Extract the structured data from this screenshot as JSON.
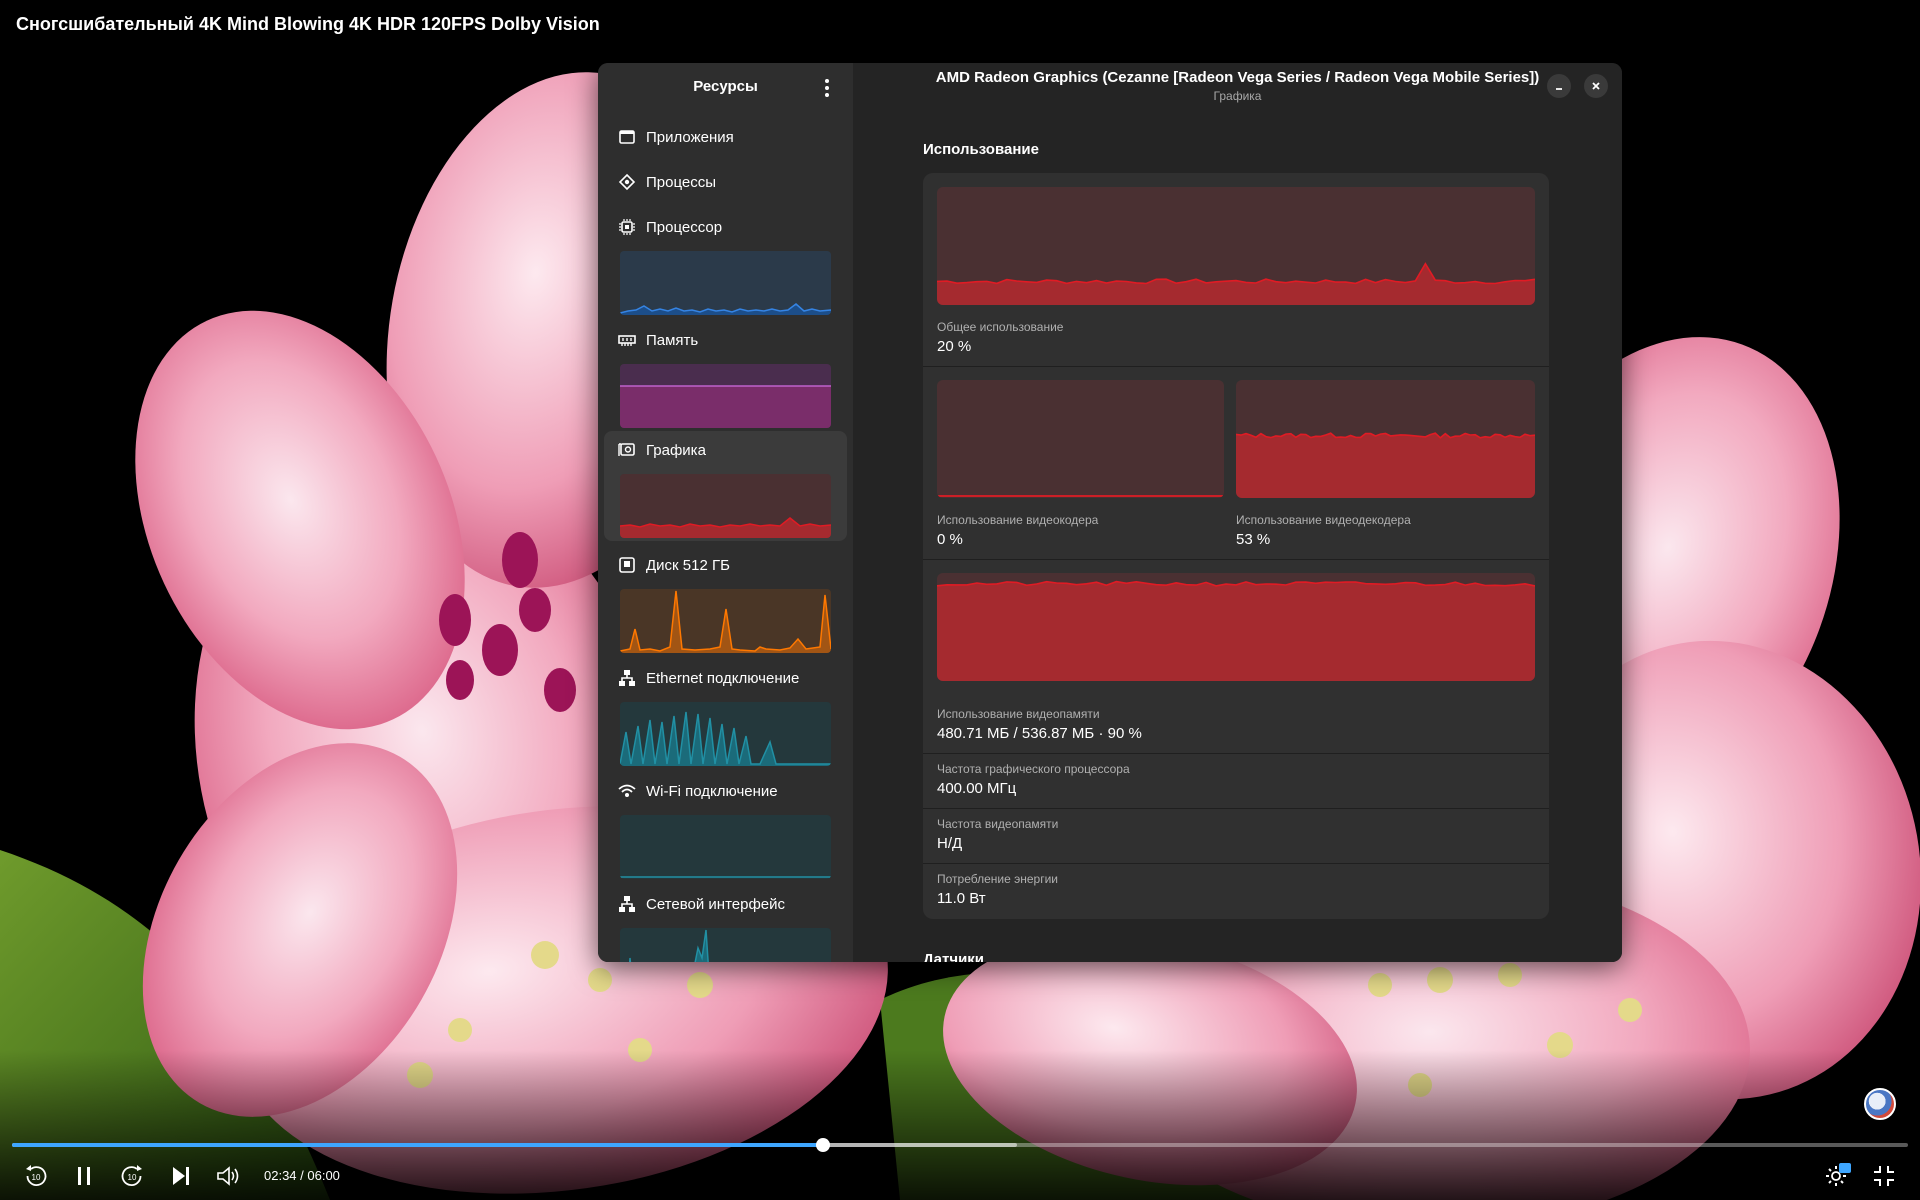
{
  "video": {
    "title": "Сногсшибательный 4K Mind Blowing 4K HDR 120FPS Dolby Vision",
    "time_display": "02:34 / 06:00",
    "played_fraction": 0.428,
    "buffered_fraction": 0.53,
    "controls": [
      "rewind-10-icon",
      "pause-icon",
      "forward-10-icon",
      "next-icon",
      "volume-icon",
      "settings-icon",
      "exit-fullscreen-icon"
    ]
  },
  "window": {
    "sidebar_title": "Ресурсы",
    "title": "AMD Radeon Graphics (Cezanne [Radeon Vega Series / Radeon Vega Mobile Series])",
    "subtitle": "Графика"
  },
  "sidebar": {
    "items": [
      {
        "label": "Приложения",
        "icon": "apps-icon",
        "color": ""
      },
      {
        "label": "Процессы",
        "icon": "processes-icon",
        "color": ""
      },
      {
        "label": "Процессор",
        "icon": "cpu-icon",
        "color": "#3584e4"
      },
      {
        "label": "Память",
        "icon": "memory-icon",
        "color": "#c061cb"
      },
      {
        "label": "Графика",
        "icon": "gpu-icon",
        "color": "#e01b24"
      },
      {
        "label": "Диск 512 ГБ",
        "icon": "disk-icon",
        "color": "#ff7800"
      },
      {
        "label": "Ethernet подключение",
        "icon": "ethernet-icon",
        "color": "#2190a4"
      },
      {
        "label": "Wi-Fi подключение",
        "icon": "wifi-icon",
        "color": "#2190a4"
      },
      {
        "label": "Сетевой интерфейс",
        "icon": "network-icon",
        "color": "#2190a4"
      }
    ]
  },
  "usage": {
    "section_title": "Использование",
    "total_label": "Общее использование",
    "total_value": "20 %",
    "encoder_label": "Использование видеокодера",
    "encoder_value": "0 %",
    "decoder_label": "Использование видеодекодера",
    "decoder_value": "53 %",
    "vram_label": "Использование видеопамяти",
    "vram_value": "480.71 МБ / 536.87 МБ · 90 %",
    "gpu_freq_label": "Частота графического процессора",
    "gpu_freq_value": "400.00 МГц",
    "vram_freq_label": "Частота видеопамяти",
    "vram_freq_value": "Н/Д",
    "power_label": "Потребление энергии",
    "power_value": "11.0 Вт"
  },
  "sensors": {
    "section_title": "Датчики"
  },
  "graph_levels": {
    "total": 0.2,
    "encoder": 0.0,
    "decoder": 0.53,
    "vram": 0.9
  }
}
